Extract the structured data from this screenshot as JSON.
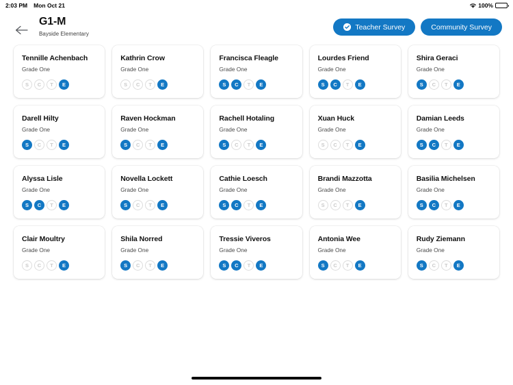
{
  "status_bar": {
    "time": "2:03 PM",
    "date": "Mon Oct 21",
    "battery_percent": "100%",
    "wifi_icon": "wifi-icon",
    "battery_icon": "battery-icon"
  },
  "header": {
    "back_icon": "back-arrow-icon",
    "title": "G1-M",
    "subtitle": "Bayside Elementary",
    "actions": [
      {
        "label": "Teacher Survey",
        "icon": "check-circle-icon",
        "has_icon": true
      },
      {
        "label": "Community Survey",
        "icon": "",
        "has_icon": false
      }
    ]
  },
  "badge_keys": [
    "S",
    "C",
    "T",
    "E"
  ],
  "colors": {
    "accent": "#1378c4",
    "badge_off_border": "#dcdcdc",
    "badge_off_text": "#c9c9c9",
    "card_bg": "#ffffff",
    "page_bg": "#ffffff"
  },
  "students": [
    {
      "name": "Tennille Achenbach",
      "grade": "Grade One",
      "badges": [
        false,
        false,
        false,
        true
      ]
    },
    {
      "name": "Kathrin Crow",
      "grade": "Grade One",
      "badges": [
        false,
        false,
        false,
        true
      ]
    },
    {
      "name": "Francisca Fleagle",
      "grade": "Grade One",
      "badges": [
        true,
        true,
        false,
        true
      ]
    },
    {
      "name": "Lourdes Friend",
      "grade": "Grade One",
      "badges": [
        true,
        true,
        false,
        true
      ]
    },
    {
      "name": "Shira Geraci",
      "grade": "Grade One",
      "badges": [
        true,
        false,
        false,
        true
      ]
    },
    {
      "name": "Darell Hilty",
      "grade": "Grade One",
      "badges": [
        true,
        false,
        false,
        true
      ]
    },
    {
      "name": "Raven Hockman",
      "grade": "Grade One",
      "badges": [
        true,
        false,
        false,
        true
      ]
    },
    {
      "name": "Rachell Hotaling",
      "grade": "Grade One",
      "badges": [
        true,
        false,
        false,
        true
      ]
    },
    {
      "name": "Xuan Huck",
      "grade": "Grade One",
      "badges": [
        false,
        false,
        false,
        true
      ]
    },
    {
      "name": "Damian Leeds",
      "grade": "Grade One",
      "badges": [
        true,
        true,
        false,
        true
      ]
    },
    {
      "name": "Alyssa Lisle",
      "grade": "Grade One",
      "badges": [
        true,
        true,
        false,
        true
      ]
    },
    {
      "name": "Novella Lockett",
      "grade": "Grade One",
      "badges": [
        true,
        false,
        false,
        true
      ]
    },
    {
      "name": "Cathie Loesch",
      "grade": "Grade One",
      "badges": [
        true,
        true,
        false,
        true
      ]
    },
    {
      "name": "Brandi Mazzotta",
      "grade": "Grade One",
      "badges": [
        false,
        false,
        false,
        true
      ]
    },
    {
      "name": "Basilia Michelsen",
      "grade": "Grade One",
      "badges": [
        true,
        true,
        false,
        true
      ]
    },
    {
      "name": "Clair Moultry",
      "grade": "Grade One",
      "badges": [
        false,
        false,
        false,
        true
      ]
    },
    {
      "name": "Shila Norred",
      "grade": "Grade One",
      "badges": [
        true,
        false,
        false,
        true
      ]
    },
    {
      "name": "Tressie Viveros",
      "grade": "Grade One",
      "badges": [
        true,
        true,
        false,
        true
      ]
    },
    {
      "name": "Antonia Wee",
      "grade": "Grade One",
      "badges": [
        true,
        false,
        false,
        true
      ]
    },
    {
      "name": "Rudy Ziemann",
      "grade": "Grade One",
      "badges": [
        true,
        false,
        false,
        true
      ]
    }
  ]
}
